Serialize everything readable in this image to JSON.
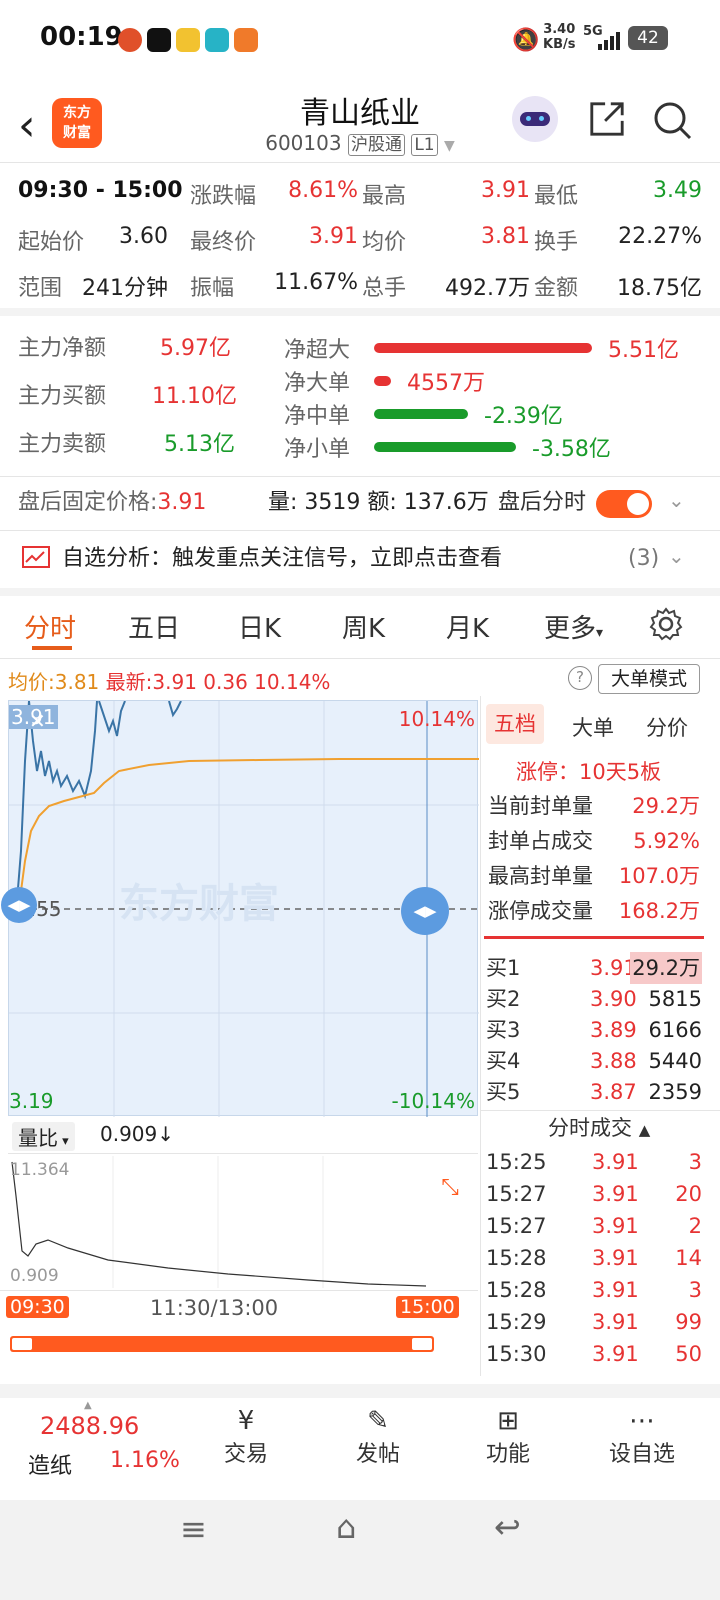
{
  "status": {
    "time": "00:19",
    "net_speed": "3.40",
    "net_unit": "KB/s",
    "signal": "5G",
    "battery": "42"
  },
  "header": {
    "logo_line1": "东方",
    "logo_line2": "财富",
    "title": "青山纸业",
    "code": "600103",
    "tag1": "沪股通",
    "tag2": "L1"
  },
  "quote": [
    [
      {
        "l": "09:30 - 15:00",
        "v": ""
      },
      {
        "l": "涨跌幅",
        "v": "8.61%"
      },
      {
        "l": "最高",
        "v": "3.91"
      },
      {
        "l": "最低",
        "v": "3.49"
      }
    ],
    [
      {
        "l": "起始价",
        "v": "3.60"
      },
      {
        "l": "最终价",
        "v": "3.91"
      },
      {
        "l": "均价",
        "v": "3.81"
      },
      {
        "l": "换手",
        "v": "22.27%"
      }
    ],
    [
      {
        "l": "范围",
        "v": "241分钟"
      },
      {
        "l": "振幅",
        "v": "11.67%"
      },
      {
        "l": "总手",
        "v": "492.7万"
      },
      {
        "l": "金额",
        "v": "18.75亿"
      }
    ]
  ],
  "fund": {
    "left": [
      {
        "l": "主力净额",
        "v": "5.97亿"
      },
      {
        "l": "主力买额",
        "v": "11.10亿"
      },
      {
        "l": "主力卖额",
        "v": "5.13亿"
      }
    ],
    "bars": [
      {
        "l": "净超大",
        "v": "5.51亿",
        "frac": 1.0,
        "color": "#e63333"
      },
      {
        "l": "净大单",
        "v": "4557万",
        "frac": 0.08,
        "color": "#e63333"
      },
      {
        "l": "净中单",
        "v": "-2.39亿",
        "frac": 0.43,
        "color": "#199b2a"
      },
      {
        "l": "净小单",
        "v": "-3.58亿",
        "frac": 0.65,
        "color": "#199b2a"
      }
    ]
  },
  "after": {
    "label": "盘后固定价格:",
    "price": "3.91",
    "vol": "量: 3519",
    "amt": "额: 137.6万",
    "toggle_label": "盘后分时"
  },
  "analysis": {
    "text": "自选分析：触发重点关注信号，立即点击查看",
    "count": "(3)"
  },
  "tabs": [
    "分时",
    "五日",
    "日K",
    "周K",
    "月K",
    "更多"
  ],
  "chartinfo": {
    "avg_label": "均价:",
    "avg": "3.81",
    "new_label": "最新:",
    "new": "3.91",
    "chg": "0.36",
    "pct": "10.14%",
    "mode": "大单模式"
  },
  "chart": {
    "top_left": "3.91",
    "top_right": "10.14%",
    "mid": "3.55",
    "bot_left": "3.19",
    "bot_right": "-10.14%",
    "watermark": "东方财富",
    "vol_label": "量比",
    "vol_val": "0.909",
    "vol_arrow": "↓",
    "vol_max": "11.364",
    "vol_min": "0.909",
    "t_start": "09:30",
    "t_mid": "11:30/13:00",
    "t_end": "15:00"
  },
  "book": {
    "tabs": [
      "五档",
      "大单",
      "分价"
    ],
    "limit": "涨停：10天5板",
    "stats": [
      {
        "l": "当前封单量",
        "v": "29.2万"
      },
      {
        "l": "封单占成交",
        "v": "5.92%"
      },
      {
        "l": "最高封单量",
        "v": "107.0万"
      },
      {
        "l": "涨停成交量",
        "v": "168.2万"
      }
    ],
    "bids": [
      {
        "l": "买1",
        "p": "3.91",
        "v": "29.2万"
      },
      {
        "l": "买2",
        "p": "3.90",
        "v": "5815"
      },
      {
        "l": "买3",
        "p": "3.89",
        "v": "6166"
      },
      {
        "l": "买4",
        "p": "3.88",
        "v": "5440"
      },
      {
        "l": "买5",
        "p": "3.87",
        "v": "2359"
      }
    ],
    "trades_title": "分时成交",
    "trades": [
      {
        "t": "15:25",
        "p": "3.91",
        "v": "3"
      },
      {
        "t": "15:27",
        "p": "3.91",
        "v": "20"
      },
      {
        "t": "15:27",
        "p": "3.91",
        "v": "2"
      },
      {
        "t": "15:28",
        "p": "3.91",
        "v": "14"
      },
      {
        "t": "15:28",
        "p": "3.91",
        "v": "3"
      },
      {
        "t": "15:29",
        "p": "3.91",
        "v": "99"
      },
      {
        "t": "15:30",
        "p": "3.91",
        "v": "50"
      }
    ]
  },
  "bottom": {
    "index_val": "2488.96",
    "index_name": "造纸",
    "index_pct": "1.16%",
    "items": [
      "交易",
      "发帖",
      "功能",
      "设自选"
    ]
  },
  "colors": {
    "accent": "#ff5a1f",
    "up": "#e63333",
    "down": "#199b2a",
    "chart_bg": "#e7f0fb",
    "price_line": "#3a74a6",
    "avg_line": "#f0a030"
  }
}
